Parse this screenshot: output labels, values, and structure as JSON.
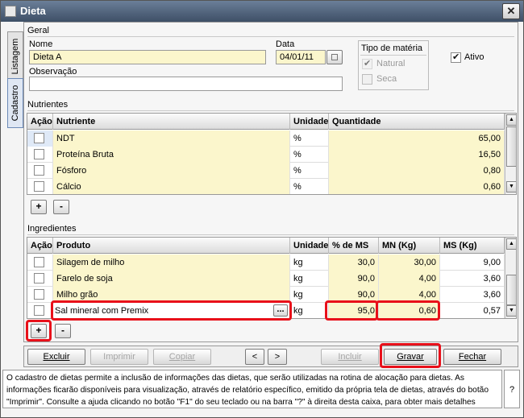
{
  "window": {
    "title": "Dieta",
    "close_glyph": "✕"
  },
  "tabs": {
    "listagem": "Listagem",
    "cadastro": "Cadastro"
  },
  "geral": {
    "section_label": "Geral",
    "nome_label": "Nome",
    "nome_value": "Dieta A",
    "data_label": "Data",
    "data_value": "04/01/11",
    "observacao_label": "Observação",
    "observacao_value": "",
    "tipo_materia_label": "Tipo de matéria",
    "natural_label": "Natural",
    "seca_label": "Seca",
    "ativo_label": "Ativo"
  },
  "nutrientes": {
    "section_label": "Nutrientes",
    "headers": {
      "acao": "Ação",
      "nutriente": "Nutriente",
      "unidade": "Unidade",
      "quantidade": "Quantidade"
    },
    "rows": [
      {
        "nome": "NDT",
        "unidade": "%",
        "quantidade": "65,00"
      },
      {
        "nome": "Proteína Bruta",
        "unidade": "%",
        "quantidade": "16,50"
      },
      {
        "nome": "Fósforo",
        "unidade": "%",
        "quantidade": "0,80"
      },
      {
        "nome": "Cálcio",
        "unidade": "%",
        "quantidade": "0,60"
      }
    ],
    "add_label": "+",
    "remove_label": "-"
  },
  "ingredientes": {
    "section_label": "Ingredientes",
    "headers": {
      "acao": "Ação",
      "produto": "Produto",
      "unidade": "Unidade",
      "pct_ms": "% de MS",
      "mn": "MN (Kg)",
      "ms": "MS (Kg)"
    },
    "rows": [
      {
        "produto": "Silagem de milho",
        "unidade": "kg",
        "pct_ms": "30,0",
        "mn": "30,00",
        "ms": "9,00"
      },
      {
        "produto": "Farelo de soja",
        "unidade": "kg",
        "pct_ms": "90,0",
        "mn": "4,00",
        "ms": "3,60"
      },
      {
        "produto": "Milho grão",
        "unidade": "kg",
        "pct_ms": "90,0",
        "mn": "4,00",
        "ms": "3,60"
      },
      {
        "produto": "Sal mineral com Premix",
        "unidade": "kg",
        "pct_ms": "95,0",
        "mn": "0,60",
        "ms": "0,57"
      }
    ],
    "ellipsis_label": "...",
    "add_label": "+",
    "remove_label": "-"
  },
  "toolbar": {
    "excluir": "Excluir",
    "imprimir": "Imprimir",
    "copiar": "Copiar",
    "prev": "<",
    "next": ">",
    "incluir": "Incluir",
    "gravar": "Gravar",
    "fechar": "Fechar"
  },
  "help": {
    "text": "O cadastro de dietas permite a inclusão de informações das dietas, que serão utilizadas na rotina de alocação para dietas. As informações ficarão disponíveis para visualização, através de relatório específico, emitido da própria tela de dietas, através do botão \"Imprimir\". Consulte a ajuda clicando no botão \"F1\" do seu teclado ou na barra \"?\" à direita desta caixa, para obter mais detalhes",
    "question": "?"
  },
  "colors": {
    "field_yellow": "#fbf6cc",
    "highlight_red": "#e8101a",
    "titlebar": "#4a5b73"
  }
}
